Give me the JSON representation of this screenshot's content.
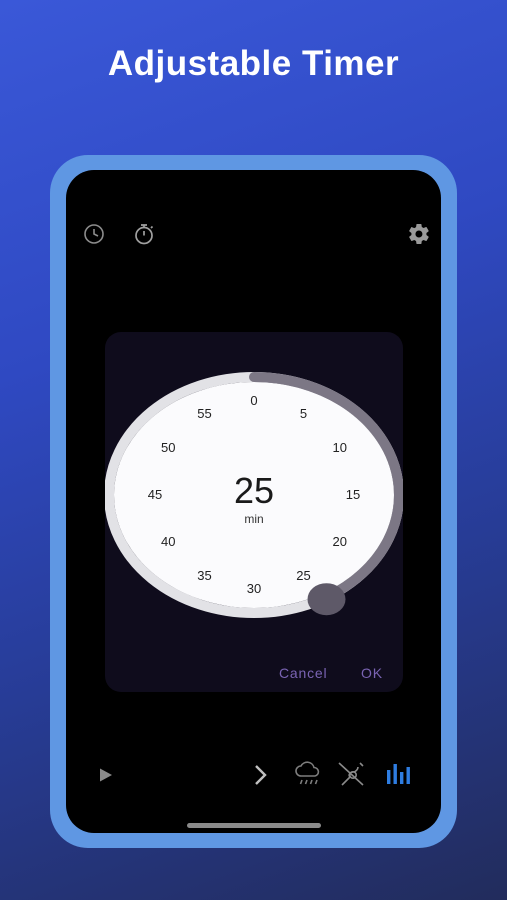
{
  "headline": "Adjustable Timer",
  "toolbar": {
    "icons": [
      "clock-icon",
      "stopwatch-icon",
      "gear-icon"
    ]
  },
  "timer_dialog": {
    "value": "25",
    "unit": "min",
    "minute_ticks": [
      "0",
      "5",
      "10",
      "15",
      "20",
      "25",
      "30",
      "35",
      "40",
      "45",
      "50",
      "55"
    ],
    "selected_fraction": 0.4167,
    "cancel_label": "Cancel",
    "ok_label": "OK"
  },
  "bottom_bar": {
    "icons": [
      "play-icon",
      "chevron-right-icon",
      "rain-cloud-icon",
      "no-violin-icon",
      "equalizer-icon"
    ]
  },
  "colors": {
    "accent": "#7a64b3",
    "progress_arc": "#7c7785",
    "dial_face": "#fbfbfd",
    "equalizer_blue": "#2e7de1"
  }
}
